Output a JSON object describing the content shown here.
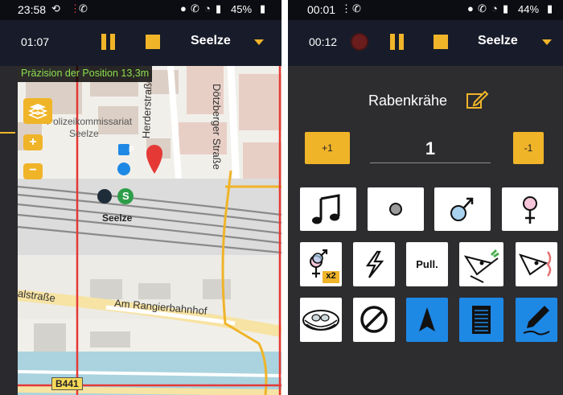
{
  "left_screen": {
    "status": {
      "time": "23:58",
      "battery": "45%"
    },
    "toolbar": {
      "timer": "01:07",
      "location": "Seelze"
    },
    "map": {
      "precision_text": "Präzision der Position 13,3m",
      "zoom_in": "+",
      "zoom_out": "−",
      "labels": {
        "police": "Polizeikommissariat",
        "police2": "Seelze",
        "herderstrasse": "Herderstraße",
        "doteberger": "Dötzberger Straße",
        "station": "Seelze",
        "rangier": "Am Rangierbahnhof",
        "alstrasse": "alstraße",
        "b441": "B441",
        "parking": "P",
        "sbahn": "S"
      }
    }
  },
  "right_screen": {
    "status": {
      "time": "00:01",
      "battery": "44%"
    },
    "toolbar": {
      "timer": "00:12",
      "location": "Seelze"
    },
    "species": "Rabenkrähe",
    "counter": {
      "plus_label": "+1",
      "minus_label": "-1",
      "value": "1"
    },
    "tiles": {
      "x2_label": "x2",
      "pull_label": "Pull."
    }
  },
  "icons": {
    "music": "music-note-icon",
    "dot": "dot-icon",
    "male": "male-icon",
    "female": "female-icon",
    "pair": "pair-icon",
    "warning": "lightning-icon",
    "pull": "pull-icon",
    "bird_food": "bird-carrying-food-icon",
    "bird_warning": "bird-warning-icon",
    "nest": "nest-icon",
    "forbidden": "forbidden-icon",
    "navigation": "navigation-arrow-icon",
    "list": "list-icon",
    "edit": "edit-pen-icon"
  },
  "colors": {
    "accent": "#f0b429",
    "toolbar": "#181c2a",
    "tile_blue": "#1e88e5",
    "precision_text": "#8be04e"
  }
}
